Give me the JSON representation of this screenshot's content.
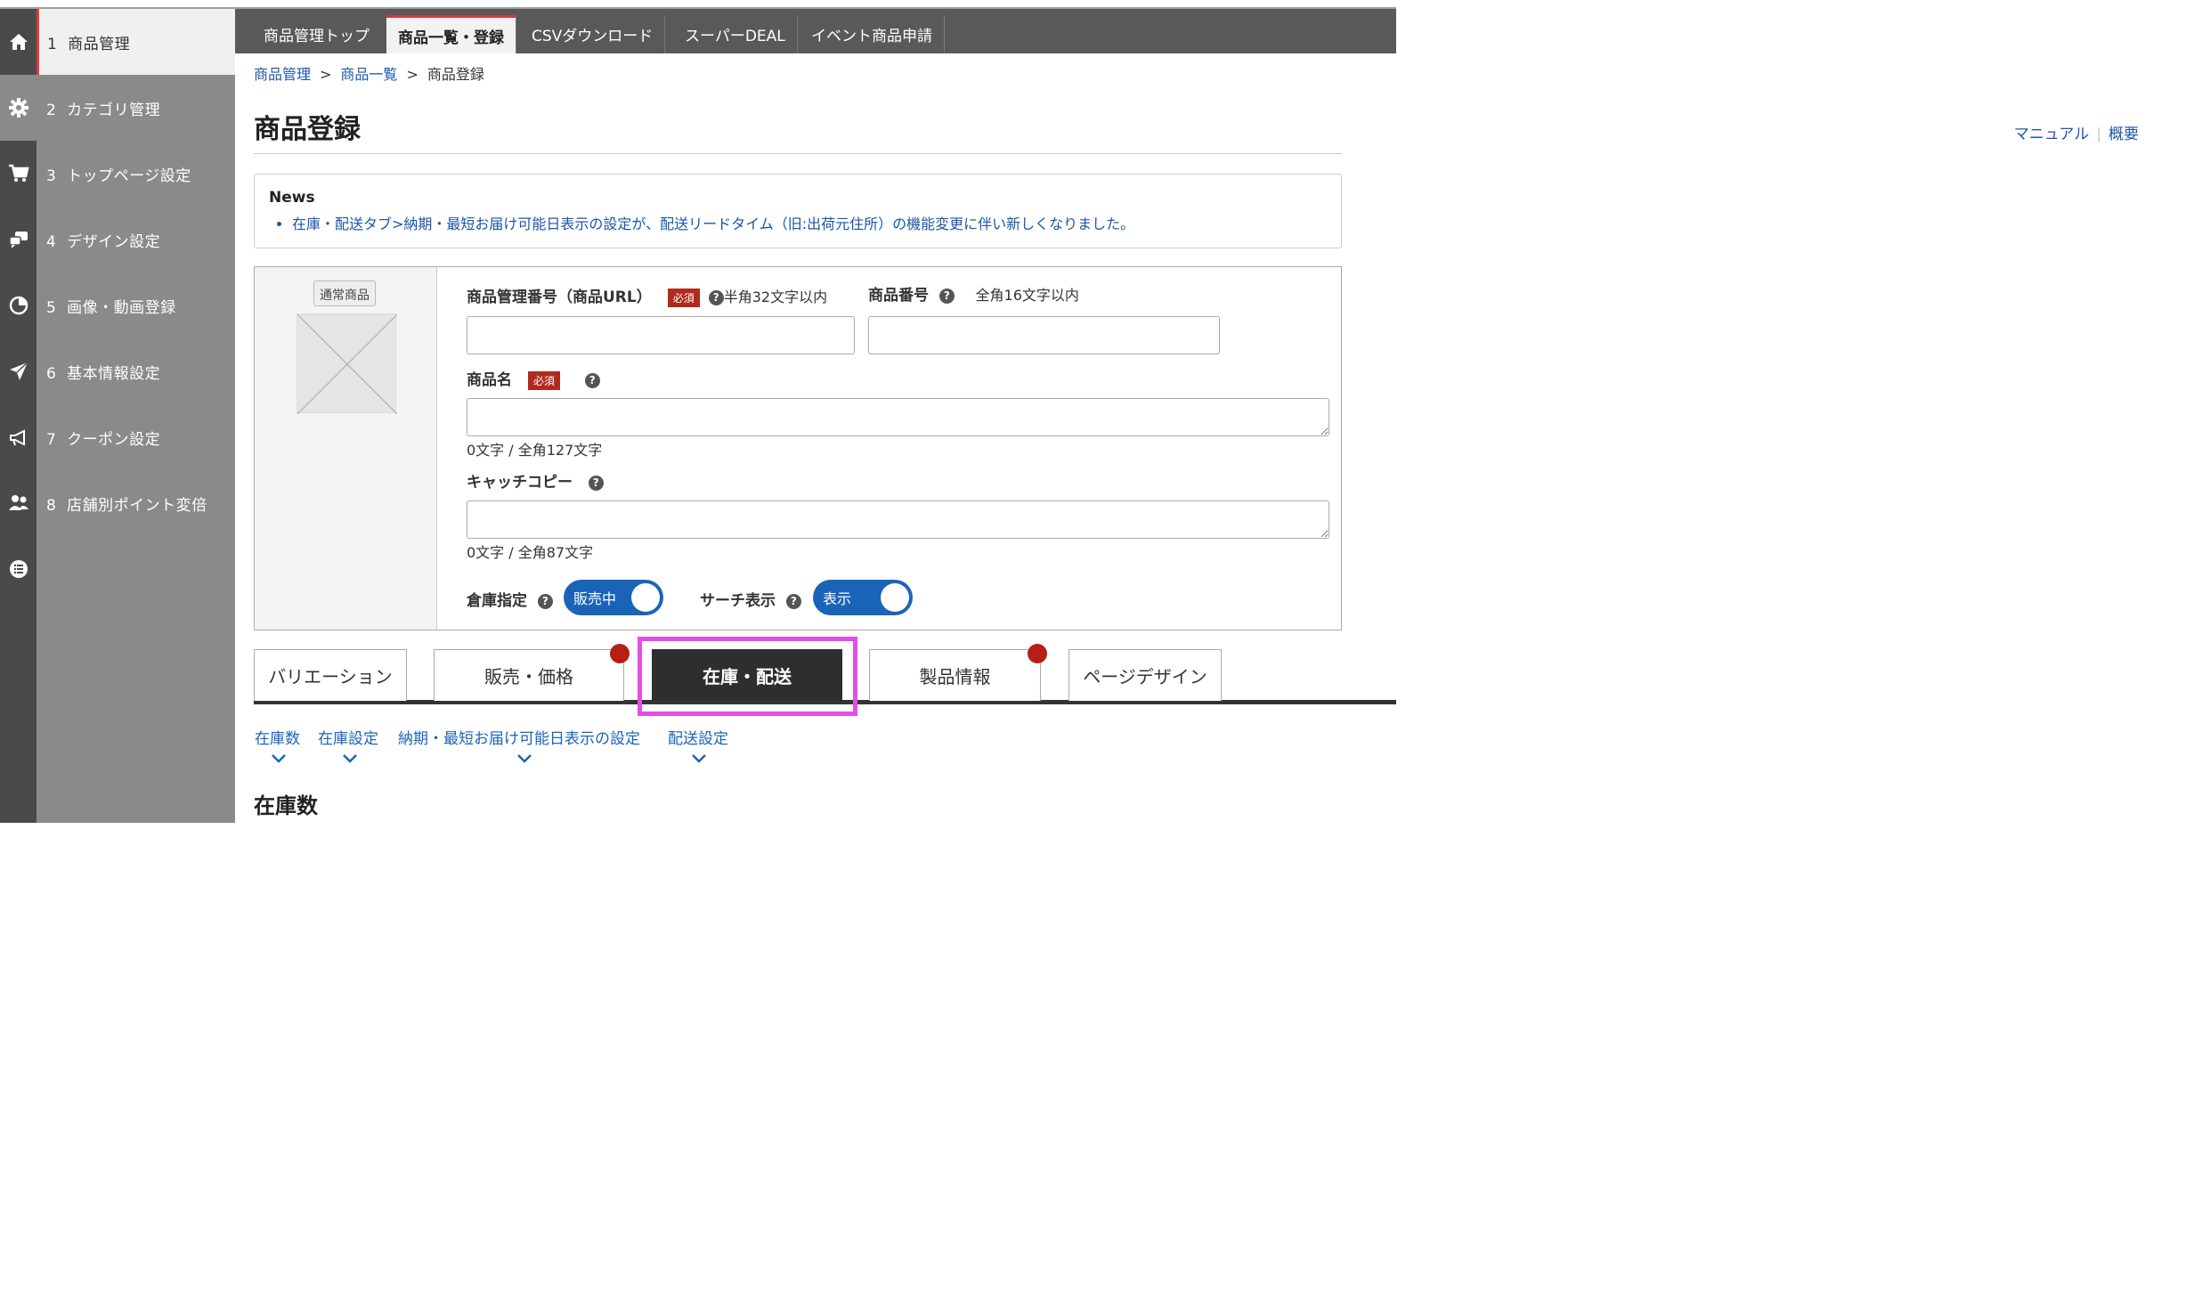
{
  "sidebar": {
    "items": [
      {
        "num": "1",
        "label": "商品管理",
        "icon": "home-icon"
      },
      {
        "num": "2",
        "label": "カテゴリ管理",
        "icon": "gear-icon"
      },
      {
        "num": "3",
        "label": "トップページ設定",
        "icon": "cart-icon"
      },
      {
        "num": "4",
        "label": "デザイン設定",
        "icon": "chat-icon"
      },
      {
        "num": "5",
        "label": "画像・動画登録",
        "icon": "pie-chart-icon"
      },
      {
        "num": "6",
        "label": "基本情報設定",
        "icon": "paper-plane-icon"
      },
      {
        "num": "7",
        "label": "クーポン設定",
        "icon": "megaphone-icon"
      },
      {
        "num": "8",
        "label": "店舗別ポイント変倍",
        "icon": "users-icon"
      }
    ]
  },
  "topnav": {
    "tabs": [
      "商品管理トップ",
      "商品一覧・登録",
      "CSVダウンロード",
      "スーパーDEAL",
      "イベント商品申請"
    ]
  },
  "breadcrumb": {
    "items": [
      "商品管理",
      "商品一覧",
      "商品登録"
    ],
    "sep": ">"
  },
  "page": {
    "title": "商品登録",
    "manual": "マニュアル",
    "overview": "概要"
  },
  "news": {
    "heading": "News",
    "item": "在庫・配送タブ>納期・最短お届け可能日表示の設定が、配送リードタイム（旧:出荷元住所）の機能変更に伴い新しくなりました。"
  },
  "form": {
    "badge": "通常商品",
    "required": "必須",
    "help": "?",
    "mgmt_label": "商品管理番号（商品URL）",
    "mgmt_note": "半角32文字以内",
    "num_label": "商品番号",
    "num_note": "全角16文字以内",
    "name_label": "商品名",
    "name_count": "0文字 / 全角127文字",
    "catch_label": "キャッチコピー",
    "catch_count": "0文字 / 全角87文字",
    "warehouse_label": "倉庫指定",
    "warehouse_value": "販売中",
    "search_label": "サーチ表示",
    "search_value": "表示"
  },
  "bottom_tabs": [
    "バリエーション",
    "販売・価格",
    "在庫・配送",
    "製品情報",
    "ページデザイン"
  ],
  "anchors": [
    "在庫数",
    "在庫設定",
    "納期・最短お届け可能日表示の設定",
    "配送設定"
  ],
  "section": {
    "title": "在庫数"
  },
  "colors": {
    "accent_blue": "#1a64b8",
    "required_red": "#b02a1e",
    "highlight": "#e64ce6",
    "nav_bg": "#595959"
  }
}
